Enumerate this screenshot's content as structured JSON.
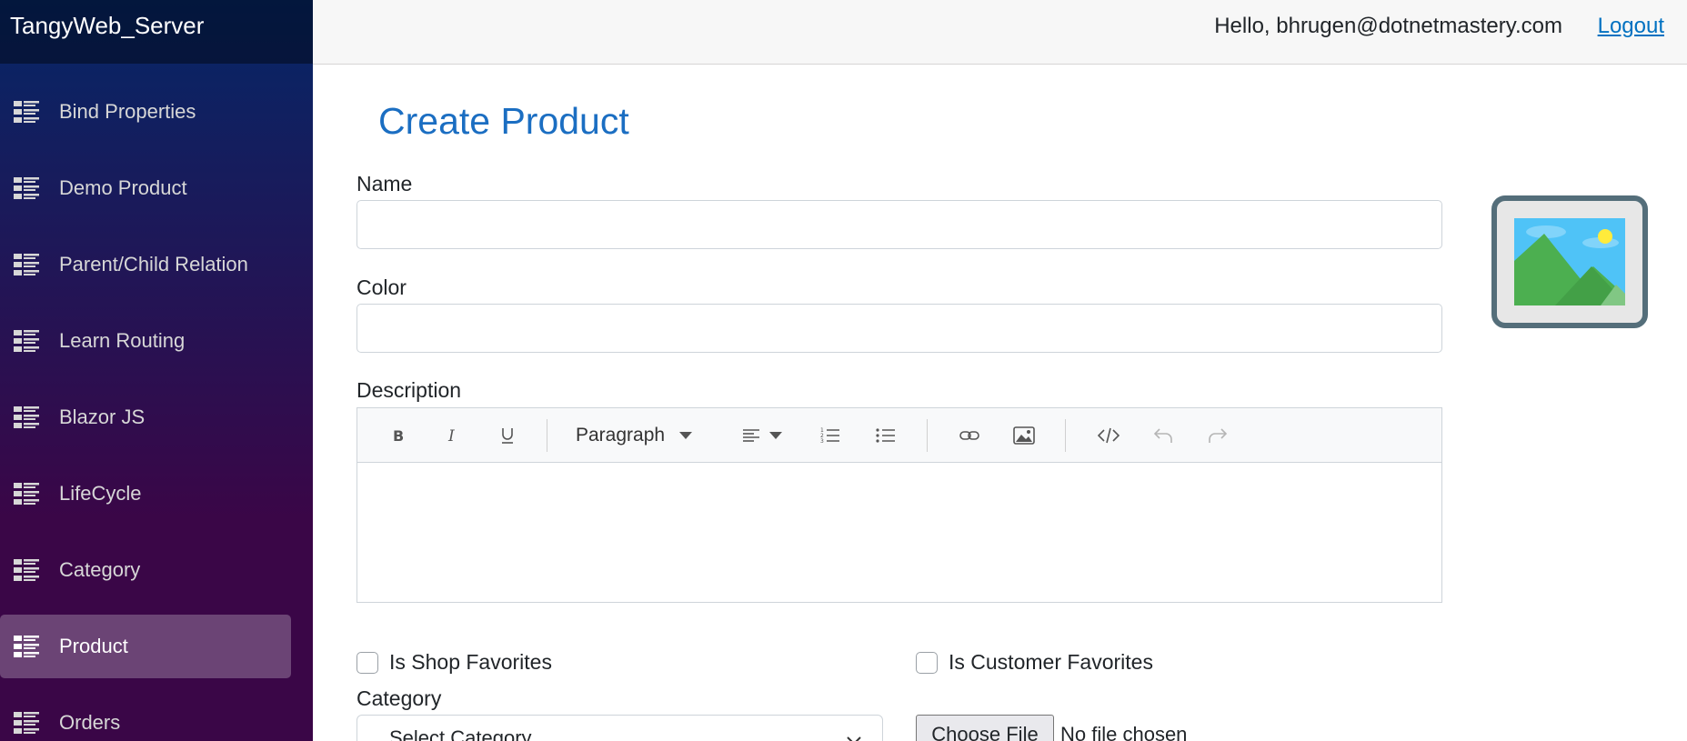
{
  "app": {
    "brand": "TangyWeb_Server"
  },
  "topbar": {
    "greeting": "Hello, bhrugen@dotnetmastery.com",
    "logout_label": "Logout"
  },
  "sidebar": {
    "items": [
      {
        "label": "Bind Properties",
        "active": false
      },
      {
        "label": "Demo Product",
        "active": false
      },
      {
        "label": "Parent/Child Relation",
        "active": false
      },
      {
        "label": "Learn Routing",
        "active": false
      },
      {
        "label": "Blazor JS",
        "active": false
      },
      {
        "label": "LifeCycle",
        "active": false
      },
      {
        "label": "Category",
        "active": false
      },
      {
        "label": "Product",
        "active": true
      },
      {
        "label": "Orders",
        "active": false
      }
    ]
  },
  "form": {
    "title": "Create Product",
    "name_label": "Name",
    "name_value": "",
    "color_label": "Color",
    "color_value": "",
    "description_label": "Description",
    "editor": {
      "paragraph_label": "Paragraph",
      "tools": [
        "bold-icon",
        "italic-icon",
        "underline-icon",
        "paragraph-dropdown",
        "align-icon",
        "ordered-list-icon",
        "unordered-list-icon",
        "link-icon",
        "image-icon",
        "code-icon",
        "undo-icon",
        "redo-icon"
      ]
    },
    "is_shop_favorites_label": "Is Shop Favorites",
    "is_shop_favorites_checked": false,
    "is_customer_favorites_label": "Is Customer Favorites",
    "is_customer_favorites_checked": false,
    "category_label": "Category",
    "category_selected": "Select Category",
    "file_button_label": "Choose File",
    "file_status": "No file chosen"
  },
  "colors": {
    "accent": "#1b6ec2",
    "link": "#0071c1"
  }
}
